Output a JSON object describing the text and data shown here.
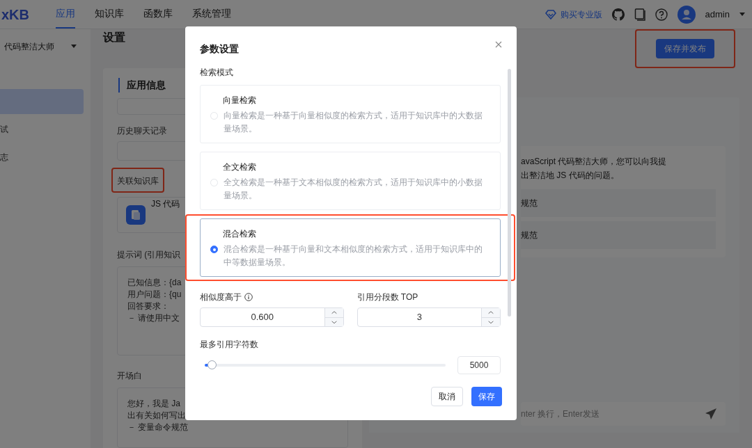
{
  "header": {
    "logo": "xKB",
    "nav": [
      {
        "label": "应用",
        "selected": true
      },
      {
        "label": "知识库",
        "selected": false
      },
      {
        "label": "函数库",
        "selected": false
      },
      {
        "label": "系统管理",
        "selected": false
      }
    ],
    "upgrade_link": "购买专业版",
    "user": "admin"
  },
  "sidebar": {
    "app_name": "代码整洁大师",
    "items": [
      {
        "selected": true
      },
      {
        "label": "试",
        "selected": false
      },
      {
        "label": "志",
        "selected": false
      }
    ]
  },
  "page": {
    "title": "设置",
    "publish_button": {
      "label": "保存并发布",
      "highlighted": true
    }
  },
  "settings": {
    "section": "应用信息",
    "history_label": "历史聊天记录",
    "kb_label": {
      "text": "关联知识库",
      "highlighted": true
    },
    "kb_item": "JS 代码",
    "prompt_label": "提示词 (引用知识",
    "prompt_lines": [
      "已知信息：{da",
      "用户问题：{qu",
      "回答要求：",
      "－ 请使用中文"
    ],
    "opening_label": "开场白",
    "opening_lines": [
      "您好，我是 Ja",
      "出有关如何写出",
      "－ 变量命令规范"
    ]
  },
  "preview": {
    "message_lines": [
      "avaScript 代码整洁大师，您可以向我提",
      "出整洁地 JS 代码的问题。"
    ],
    "suggestions": [
      "规范",
      "规范"
    ],
    "input_placeholder": "nter 换行，Enter发送"
  },
  "dialog": {
    "title": "参数设置",
    "section": "检索模式",
    "modes": [
      {
        "title": "向量检索",
        "description": "向量检索是一种基于向量相似度的检索方式，适用于知识库中的大数据量场景。",
        "selected": false,
        "highlighted": false
      },
      {
        "title": "全文检索",
        "description": "全文检索是一种基于文本相似度的检索方式，适用于知识库中的小数据量场景。",
        "selected": false,
        "highlighted": false
      },
      {
        "title": "混合检索",
        "description": "混合检索是一种基于向量和文本相似度的检索方式，适用于知识库中的中等数据量场景。",
        "selected": true,
        "highlighted": true
      }
    ],
    "similarity": {
      "label": "相似度高于",
      "value": "0.600"
    },
    "top_n": {
      "label": "引用分段数 TOP",
      "value": "3"
    },
    "max_chars": {
      "label": "最多引用字符数",
      "level": 0.03,
      "value": "5000"
    },
    "buttons": [
      {
        "label": "取消",
        "kind": "secondary"
      },
      {
        "label": "保存",
        "kind": "primary"
      }
    ]
  }
}
